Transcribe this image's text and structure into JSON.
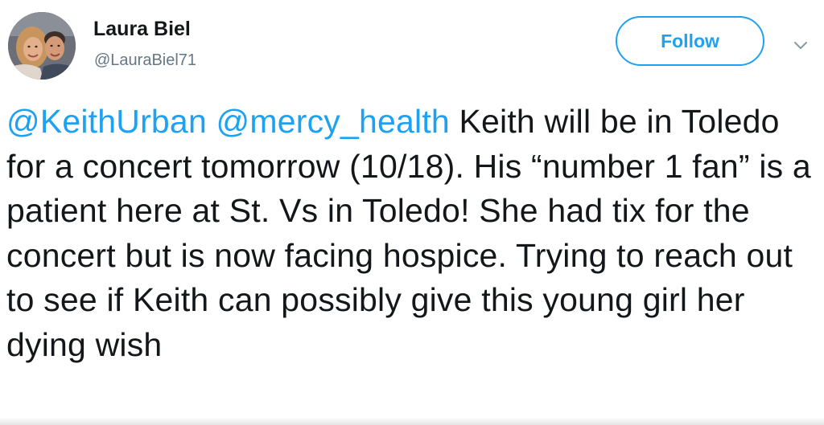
{
  "author": {
    "name": "Laura Biel",
    "handle": "@LauraBiel71"
  },
  "follow_button": {
    "label": "Follow"
  },
  "tweet": {
    "mentions": [
      "@KeithUrban",
      "@mercy_health"
    ],
    "body": "Keith will be in Toledo for a concert tomorrow (10/18). His “number 1 fan” is a patient here at St. Vs in Toledo!  She had tix for the concert but is now facing hospice. Trying to reach out to see if Keith can possibly give this young girl her dying wish"
  },
  "icons": {
    "avatar": "profile-photo",
    "caret": "chevron-down-icon"
  },
  "colors": {
    "accent": "#1da1f2",
    "name_text": "#14171a",
    "handle_text": "#657786"
  }
}
